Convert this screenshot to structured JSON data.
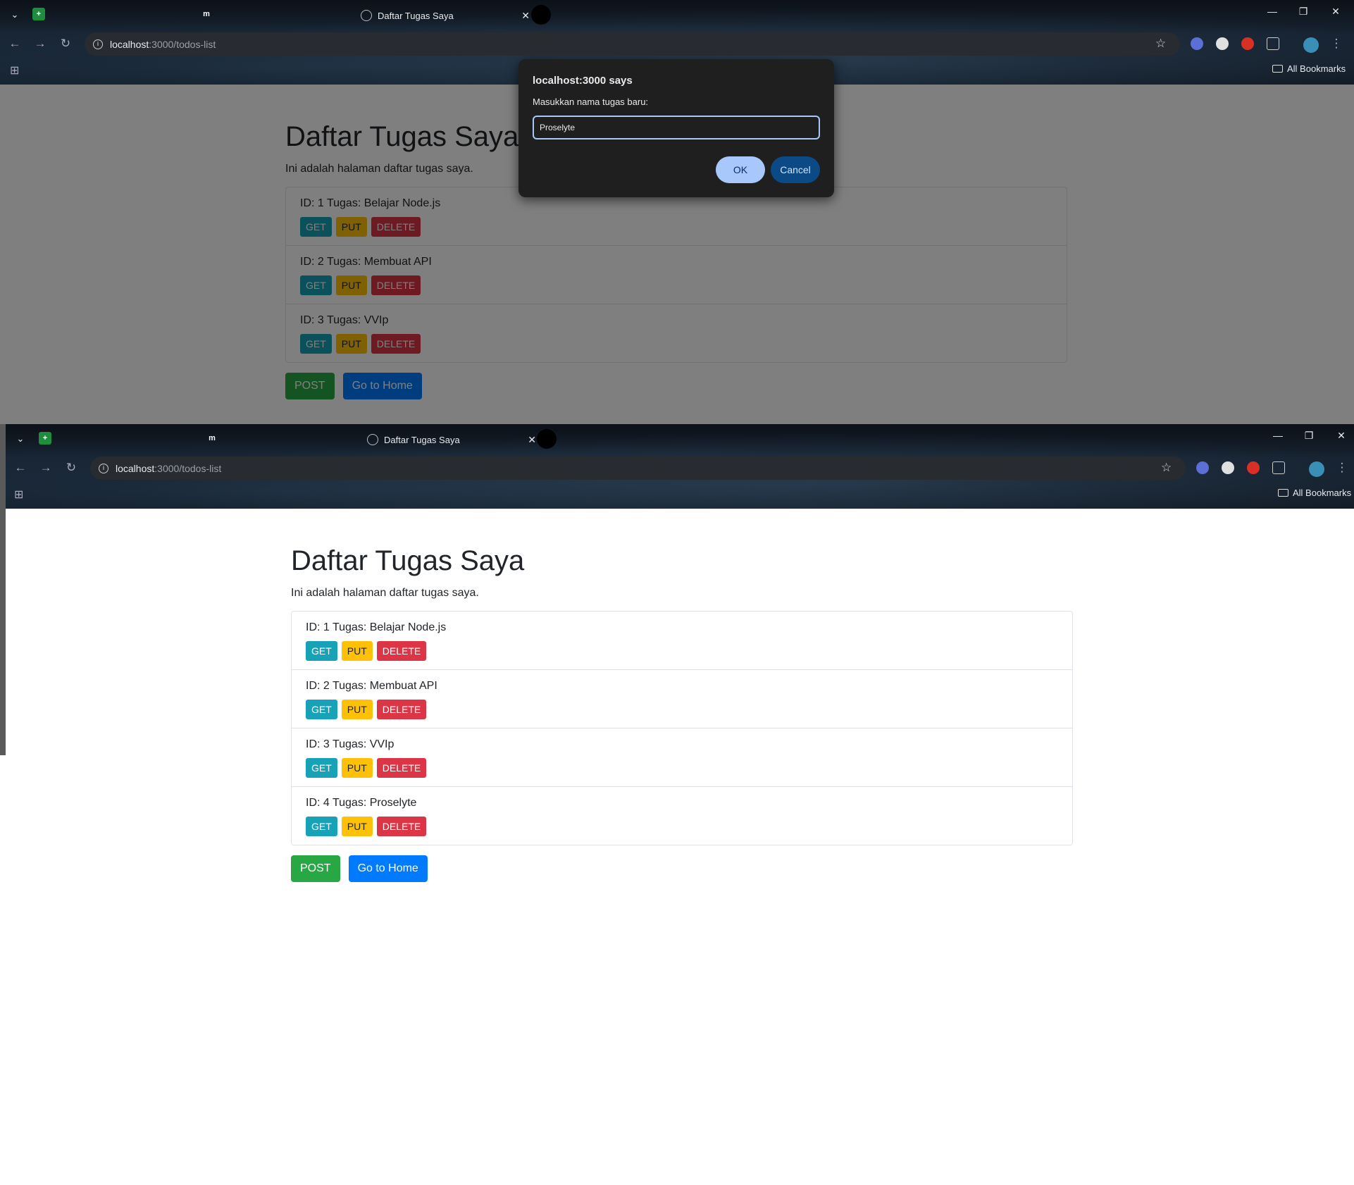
{
  "browser": {
    "tab_title": "Daftar Tugas Saya",
    "tab_close": "✕",
    "tab_chevron": "⌄",
    "sheets_fav": "+",
    "mi_fav": "m",
    "url_host": "localhost",
    "url_path": ":3000/todos-list",
    "info_glyph": "i",
    "star": "☆",
    "bookmarks_label": "All Bookmarks",
    "win_min": "—",
    "win_restore": "❐",
    "win_close": "✕",
    "back": "←",
    "forward": "→",
    "reload": "↻",
    "apps_glyph": "⊞",
    "menu_glyph": "⋮"
  },
  "page": {
    "title": "Daftar Tugas Saya",
    "subtitle": "Ini adalah halaman daftar tugas saya.",
    "button_get": "GET",
    "button_put": "PUT",
    "button_delete": "DELETE",
    "button_post": "POST",
    "button_home": "Go to Home"
  },
  "todos_before": [
    {
      "text": "ID: 1 Tugas: Belajar Node.js"
    },
    {
      "text": "ID: 2 Tugas: Membuat API"
    },
    {
      "text": "ID: 3 Tugas: VVIp"
    }
  ],
  "todos_after": [
    {
      "text": "ID: 1 Tugas: Belajar Node.js"
    },
    {
      "text": "ID: 2 Tugas: Membuat API"
    },
    {
      "text": "ID: 3 Tugas: VVIp"
    },
    {
      "text": "ID: 4 Tugas: Proselyte"
    }
  ],
  "dialog": {
    "title": "localhost:3000 says",
    "message": "Masukkan nama tugas baru:",
    "input_value": "Proselyte",
    "ok_label": "OK",
    "cancel_label": "Cancel"
  },
  "colors": {
    "get": "#17a2b8",
    "put": "#ffc107",
    "delete": "#dc3545",
    "post": "#28a745",
    "home": "#007bff"
  }
}
